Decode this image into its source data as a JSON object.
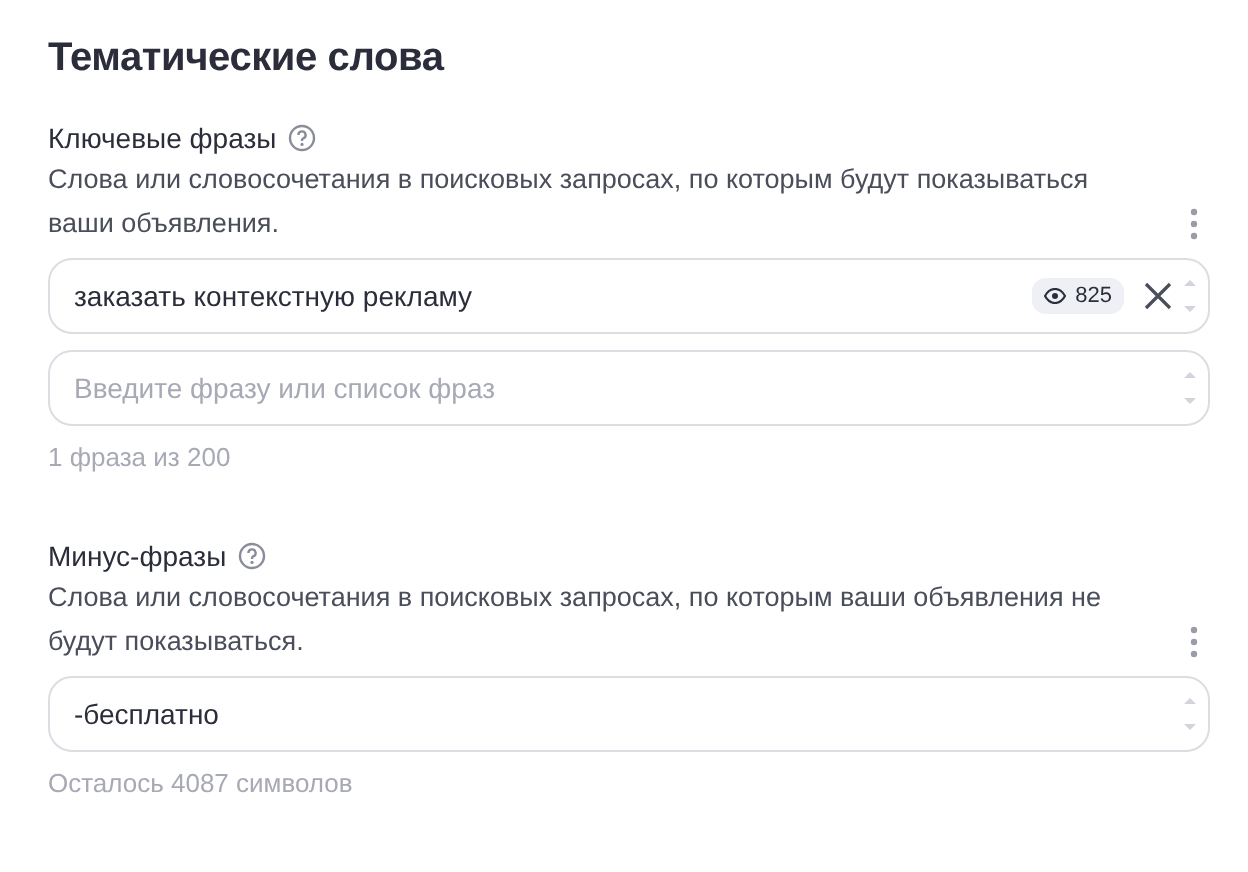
{
  "title": "Тематические слова",
  "sections": [
    {
      "label": "Ключевые фразы",
      "description": "Слова или словосочетания в поисковых запросах, по которым будут показываться ваши объявления.",
      "fields": [
        {
          "kind": "phrase",
          "value": "заказать контекстную рекламу",
          "views": "825"
        },
        {
          "kind": "input",
          "placeholder": "Введите фразу или список фраз"
        }
      ],
      "hint": "1 фраза из 200"
    },
    {
      "label": "Минус-фразы",
      "description": "Слова или словосочетания в поисковых запросах, по которым ваши объявления не будут показываться.",
      "fields": [
        {
          "kind": "phrase",
          "value": "-бесплатно"
        }
      ],
      "hint": "Осталось 4087 символов"
    }
  ]
}
